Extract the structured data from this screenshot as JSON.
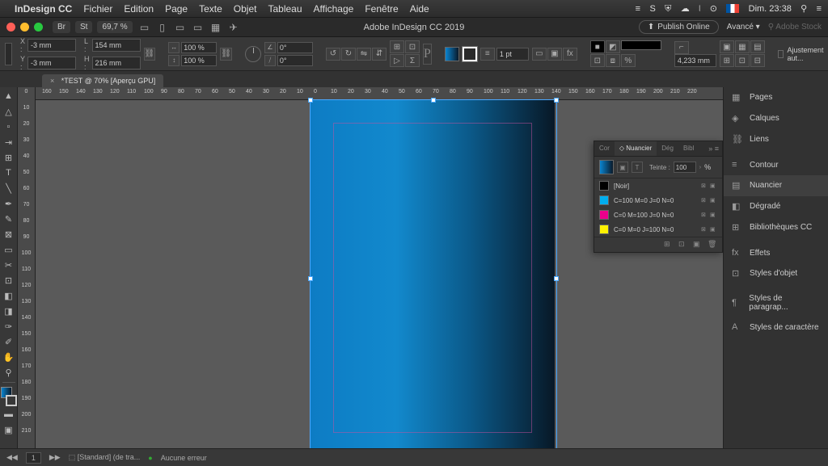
{
  "menubar": {
    "app": "InDesign CC",
    "items": [
      "Fichier",
      "Edition",
      "Page",
      "Texte",
      "Objet",
      "Tableau",
      "Affichage",
      "Fenêtre",
      "Aide"
    ],
    "clock": "Dim. 23:38"
  },
  "window": {
    "zoom": "69,7 %",
    "title": "Adobe InDesign CC 2019",
    "publish": "Publish Online",
    "advanced": "Avancé",
    "stock": "Adobe Stock"
  },
  "controls": {
    "x": "-3 mm",
    "y": "-3 mm",
    "w": "154 mm",
    "h": "216 mm",
    "sx": "100 %",
    "sy": "100 %",
    "angle": "0°",
    "shear": "0°",
    "strokeW": "1 pt",
    "eff": "4,233 mm",
    "ajust": "Ajustement aut..."
  },
  "tab": {
    "label": "*TEST @ 70% [Aperçu GPU]"
  },
  "ruler": {
    "h": [
      "160",
      "150",
      "140",
      "130",
      "120",
      "110",
      "100",
      "90",
      "80",
      "70",
      "60",
      "50",
      "40",
      "30",
      "20",
      "10",
      "0",
      "10",
      "20",
      "30",
      "40",
      "50",
      "60",
      "70",
      "80",
      "90",
      "100",
      "110",
      "120",
      "130",
      "140",
      "150",
      "160",
      "170",
      "180",
      "190",
      "200",
      "210",
      "220"
    ],
    "v": [
      "0",
      "10",
      "20",
      "30",
      "40",
      "50",
      "60",
      "70",
      "80",
      "90",
      "100",
      "110",
      "120",
      "130",
      "140",
      "150",
      "160",
      "170",
      "180",
      "190",
      "200",
      "210"
    ]
  },
  "swatches": {
    "tabs": [
      "Cor",
      "Nuancier",
      "Dég",
      "Bibl"
    ],
    "teinte_label": "Teinte :",
    "teinte": "100",
    "pct": "%",
    "items": [
      {
        "name": "[Noir]",
        "color": "#000000"
      },
      {
        "name": "C=100 M=0 J=0 N=0",
        "color": "#00AEEF"
      },
      {
        "name": "C=0 M=100 J=0 N=0",
        "color": "#EC008C"
      },
      {
        "name": "C=0 M=0 J=100 N=0",
        "color": "#FFF200"
      }
    ]
  },
  "dock": [
    {
      "icon": "▦",
      "label": "Pages"
    },
    {
      "icon": "◈",
      "label": "Calques"
    },
    {
      "icon": "⛓",
      "label": "Liens"
    },
    {
      "sep": true
    },
    {
      "icon": "≡",
      "label": "Contour"
    },
    {
      "icon": "▤",
      "label": "Nuancier",
      "active": true
    },
    {
      "icon": "◧",
      "label": "Dégradé"
    },
    {
      "icon": "⊞",
      "label": "Bibliothèques CC"
    },
    {
      "sep": true
    },
    {
      "icon": "fx",
      "label": "Effets"
    },
    {
      "icon": "⊡",
      "label": "Styles d'objet"
    },
    {
      "sep": true
    },
    {
      "icon": "¶",
      "label": "Styles de paragrap..."
    },
    {
      "icon": "A",
      "label": "Styles de caractère"
    }
  ],
  "status": {
    "page": "1",
    "spread": "[Standard] (de tra...",
    "errors": "Aucune erreur"
  }
}
